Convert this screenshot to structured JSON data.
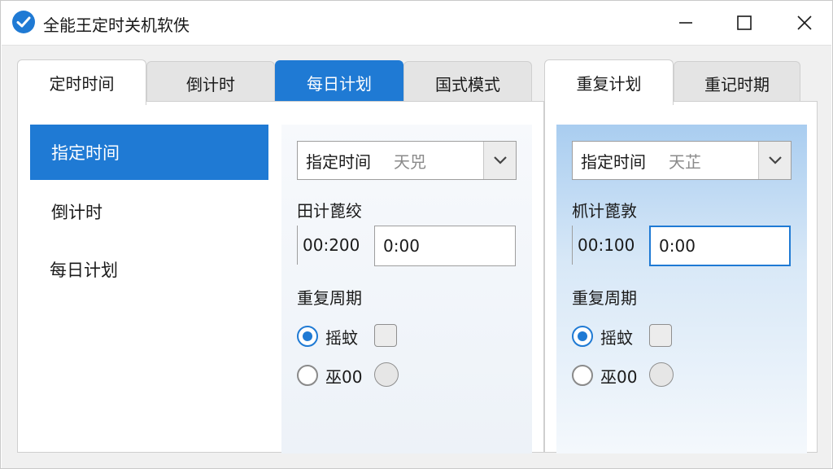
{
  "window": {
    "title": "全能王定时关机软佚",
    "controls": {
      "minimize": "minimize-icon",
      "maximize": "maximize-icon",
      "close": "close-icon"
    }
  },
  "tabs_left": [
    {
      "label": "定时时间",
      "state": "selected"
    },
    {
      "label": "倒计时",
      "state": "normal"
    },
    {
      "label": "每日计划",
      "state": "highlighted"
    },
    {
      "label": "国式模式",
      "state": "normal"
    }
  ],
  "tabs_right": [
    {
      "label": "重复计划",
      "state": "selected"
    },
    {
      "label": "重记时期",
      "state": "normal"
    }
  ],
  "sidebar": {
    "items": [
      {
        "label": "指定时间",
        "active": true
      },
      {
        "label": "倒计时",
        "active": false
      },
      {
        "label": "每日计划",
        "active": false
      }
    ]
  },
  "left_form": {
    "dropdown_value": "指定时间",
    "dropdown_hint": "天兕",
    "time_label": "田计蓖绞",
    "time_prefix": "00:200",
    "time_value": "0:00",
    "repeat_label": "重复周期",
    "option1": "摇蚊",
    "option2": "巫00"
  },
  "right_form": {
    "dropdown_value": "指定时间",
    "dropdown_hint": "天芷",
    "time_label": "枛计蓖敦",
    "time_prefix": "00:100",
    "time_value": "0:00",
    "repeat_label": "重复周期",
    "option1": "摇蚊",
    "option2": "巫00"
  },
  "colors": {
    "accent": "#1f7ad4",
    "panel_gradient_top": "#a9cdf0",
    "background": "#f0f0f0"
  }
}
